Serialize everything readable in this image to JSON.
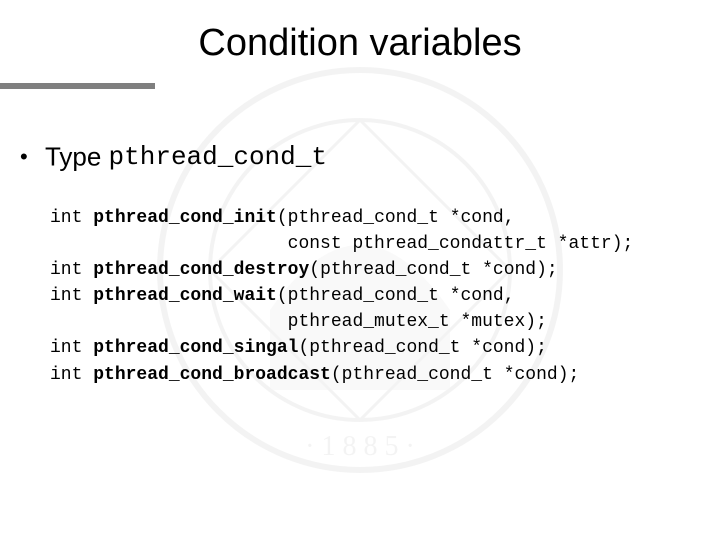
{
  "slide": {
    "title": "Condition variables",
    "bullet": {
      "label": "Type ",
      "mono": "pthread_cond_t"
    },
    "code": {
      "l1a": "int ",
      "l1b": "pthread_cond_init",
      "l1c": "(pthread_cond_t *cond,",
      "l2": "                      const pthread_condattr_t *attr);",
      "l3a": "int ",
      "l3b": "pthread_cond_destroy",
      "l3c": "(pthread_cond_t *cond);",
      "l4a": "int ",
      "l4b": "pthread_cond_wait",
      "l4c": "(pthread_cond_t *cond,",
      "l5": "                      pthread_mutex_t *mutex);",
      "l6a": "int ",
      "l6b": "pthread_cond_singal",
      "l6c": "(pthread_cond_t *cond);",
      "l7a": "int ",
      "l7b": "pthread_cond_broadcast",
      "l7c": "(pthread_cond_t *cond);"
    }
  }
}
